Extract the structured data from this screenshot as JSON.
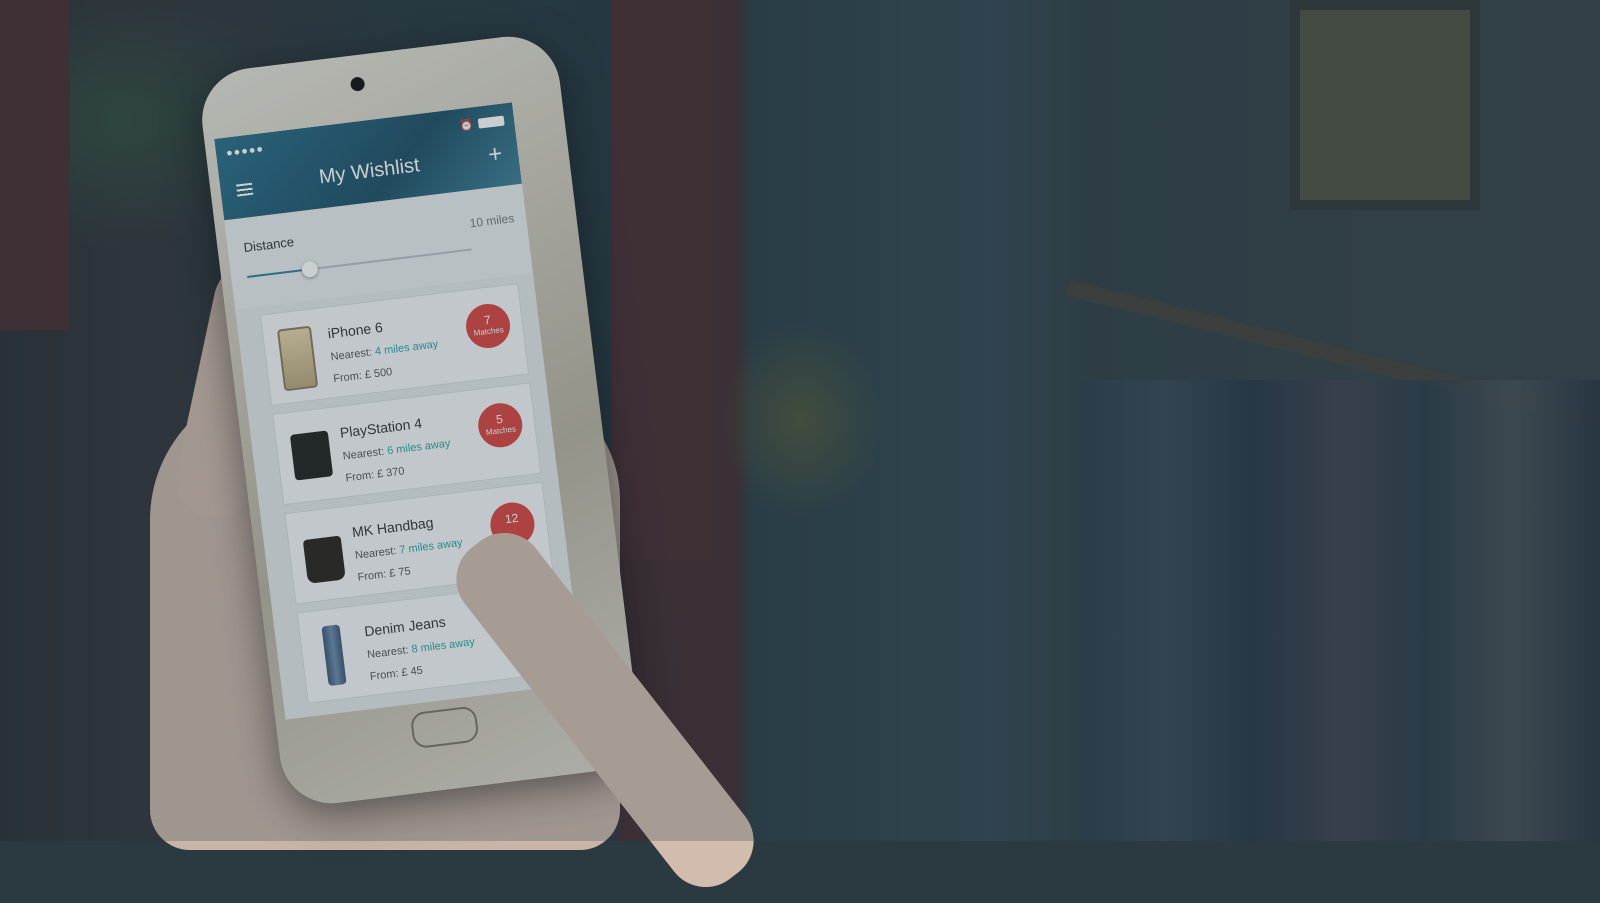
{
  "status_bar": {
    "signal": "●●●●●",
    "wifi": "wifi-icon",
    "icons": [
      "lock-rotation-icon",
      "location-arrow-icon",
      "alarm-icon",
      "battery-icon"
    ]
  },
  "app": {
    "title": "My Wishlist"
  },
  "distance": {
    "label": "Distance",
    "value": "10 miles",
    "slider_fraction": 0.28
  },
  "items": [
    {
      "name": "iPhone 6",
      "nearest_label": "Nearest:",
      "nearest": "4 miles away",
      "from": "From: £ 500",
      "matches": "7",
      "matches_label": "Matches"
    },
    {
      "name": "PlayStation 4",
      "nearest_label": "Nearest:",
      "nearest": "6 miles away",
      "from": "From: £ 370",
      "matches": "5",
      "matches_label": "Matches"
    },
    {
      "name": "MK Handbag",
      "nearest_label": "Nearest:",
      "nearest": "7 miles away",
      "from": "From: £ 75",
      "matches": "12",
      "matches_label": ""
    },
    {
      "name": "Denim Jeans",
      "nearest_label": "Nearest:",
      "nearest": "8 miles away",
      "from": "From: £ 45",
      "matches": "",
      "matches_label": ""
    }
  ],
  "colors": {
    "accent": "#2d7fa0",
    "badge": "#d9453f",
    "distance_text": "#2aa5a5"
  }
}
